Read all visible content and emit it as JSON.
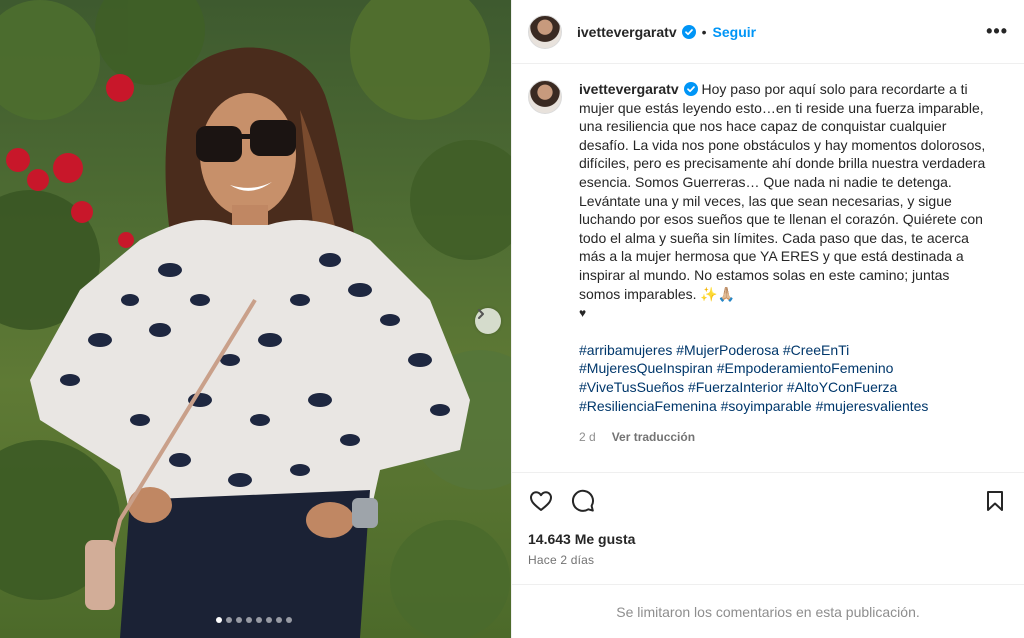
{
  "post": {
    "username": "ivettevergaratv",
    "follow_label": "Seguir",
    "bullet": "•",
    "more_icon": "more-horizontal-icon",
    "caption_paragraph_1": "Hoy paso por aquí solo para recordarte a ti mujer que estás leyendo esto…en ti reside una fuerza imparable, una resiliencia que nos hace capaz de conquistar cualquier desafío. La vida nos pone obstáculos y hay momentos dolorosos, difíciles, pero es precisamente ahí donde brilla nuestra verdadera esencia. Somos Guerreras… Que nada ni nadie te detenga. Levántate una y mil veces, las que sean necesarias, y sigue luchando por esos sueños que te llenan el corazón. Quiérete con todo el alma y sueña sin límites. Cada paso que das, te acerca más a la mujer hermosa que YA ERES y que está destinada a inspirar al mundo. No estamos solas en este camino; juntas somos imparables. ✨🙏🏼",
    "caption_heart": "♥",
    "hashtags": [
      "#arribamujeres",
      "#MujerPoderosa",
      "#CreeEnTi",
      "#MujeresQueInspiran",
      "#EmpoderamientoFemenino",
      "#ViveTusSueños",
      "#FuerzaInterior",
      "#AltoYConFuerza",
      "#ResilienciaFemenina",
      "#soyimparable",
      "#mujeresvalientes"
    ],
    "caption_age": "2 d",
    "translate_label": "Ver traducción",
    "likes_label": "14.643 Me gusta",
    "posted_ago": "Hace 2 días",
    "comments_disabled_text": "Se limitaron los comentarios en esta publicación.",
    "carousel": {
      "total": 8,
      "active_index": 0
    }
  },
  "colors": {
    "verified_blue": "#0095f6",
    "link_blue": "#00376b",
    "follow_blue": "#0095f6",
    "muted_text": "#8e8e8e"
  },
  "icons": [
    "verified-badge-icon",
    "heart-icon",
    "comment-icon",
    "bookmark-icon",
    "chevron-right-icon"
  ]
}
